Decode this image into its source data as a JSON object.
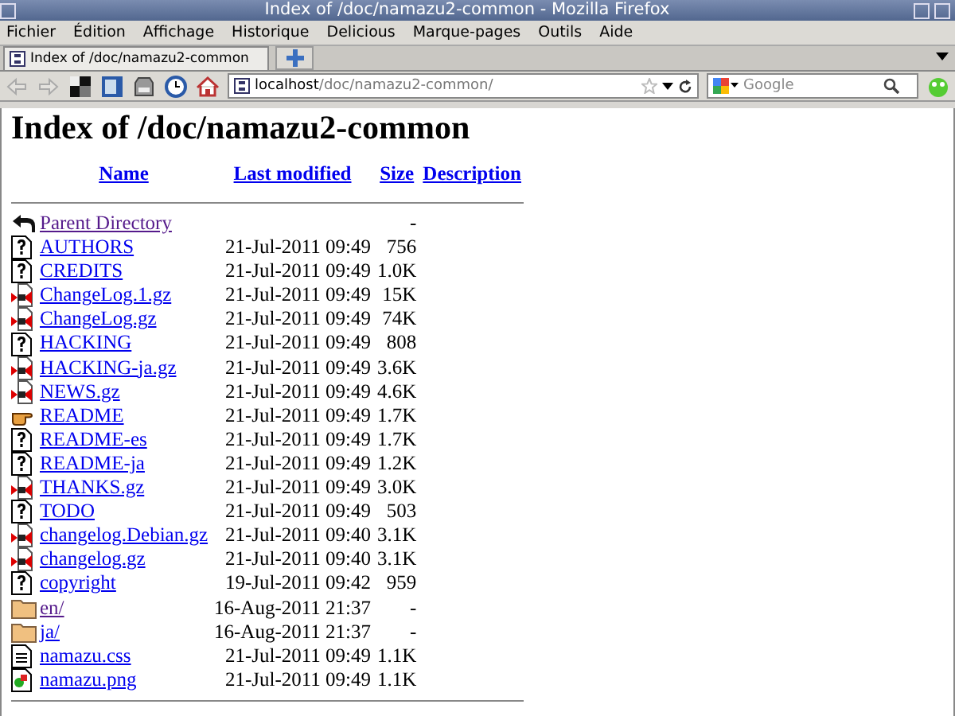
{
  "window": {
    "title": "Index of /doc/namazu2-common - Mozilla Firefox"
  },
  "menu": [
    "Fichier",
    "Édition",
    "Affichage",
    "Historique",
    "Delicious",
    "Marque-pages",
    "Outils",
    "Aide"
  ],
  "tabs": [
    {
      "label": "Index of /doc/namazu2-common",
      "selected": true
    }
  ],
  "address_bar": {
    "host": "localhost",
    "path": "/doc/namazu2-common/"
  },
  "search": {
    "placeholder": "Google"
  },
  "page": {
    "heading": "Index of /doc/namazu2-common",
    "columns": [
      "Name",
      "Last modified",
      "Size",
      "Description"
    ],
    "rows": [
      {
        "kind": "back",
        "name": "Parent Directory",
        "visited": true,
        "modified": "",
        "size": "-"
      },
      {
        "kind": "unknown",
        "name": "AUTHORS",
        "visited": false,
        "modified": "21-Jul-2011 09:49",
        "size": "756"
      },
      {
        "kind": "unknown",
        "name": "CREDITS",
        "visited": false,
        "modified": "21-Jul-2011 09:49",
        "size": "1.0K"
      },
      {
        "kind": "compressed",
        "name": "ChangeLog.1.gz",
        "visited": false,
        "modified": "21-Jul-2011 09:49",
        "size": "15K"
      },
      {
        "kind": "compressed",
        "name": "ChangeLog.gz",
        "visited": false,
        "modified": "21-Jul-2011 09:49",
        "size": "74K"
      },
      {
        "kind": "unknown",
        "name": "HACKING",
        "visited": false,
        "modified": "21-Jul-2011 09:49",
        "size": "808"
      },
      {
        "kind": "compressed",
        "name": "HACKING-ja.gz",
        "visited": false,
        "modified": "21-Jul-2011 09:49",
        "size": "3.6K"
      },
      {
        "kind": "compressed",
        "name": "NEWS.gz",
        "visited": false,
        "modified": "21-Jul-2011 09:49",
        "size": "4.6K"
      },
      {
        "kind": "hand",
        "name": "README",
        "visited": false,
        "modified": "21-Jul-2011 09:49",
        "size": "1.7K"
      },
      {
        "kind": "unknown",
        "name": "README-es",
        "visited": false,
        "modified": "21-Jul-2011 09:49",
        "size": "1.7K"
      },
      {
        "kind": "unknown",
        "name": "README-ja",
        "visited": false,
        "modified": "21-Jul-2011 09:49",
        "size": "1.2K"
      },
      {
        "kind": "compressed",
        "name": "THANKS.gz",
        "visited": false,
        "modified": "21-Jul-2011 09:49",
        "size": "3.0K"
      },
      {
        "kind": "unknown",
        "name": "TODO",
        "visited": false,
        "modified": "21-Jul-2011 09:49",
        "size": "503"
      },
      {
        "kind": "compressed",
        "name": "changelog.Debian.gz",
        "visited": false,
        "modified": "21-Jul-2011 09:40",
        "size": "3.1K"
      },
      {
        "kind": "compressed",
        "name": "changelog.gz",
        "visited": false,
        "modified": "21-Jul-2011 09:40",
        "size": "3.1K"
      },
      {
        "kind": "unknown",
        "name": "copyright",
        "visited": false,
        "modified": "19-Jul-2011 09:42",
        "size": "959"
      },
      {
        "kind": "folder",
        "name": "en/",
        "visited": true,
        "modified": "16-Aug-2011 21:37",
        "size": "-"
      },
      {
        "kind": "folder",
        "name": "ja/",
        "visited": false,
        "modified": "16-Aug-2011 21:37",
        "size": "-"
      },
      {
        "kind": "text",
        "name": "namazu.css",
        "visited": false,
        "modified": "21-Jul-2011 09:49",
        "size": "1.1K"
      },
      {
        "kind": "image",
        "name": "namazu.png",
        "visited": false,
        "modified": "21-Jul-2011 09:49",
        "size": "1.1K"
      }
    ]
  }
}
